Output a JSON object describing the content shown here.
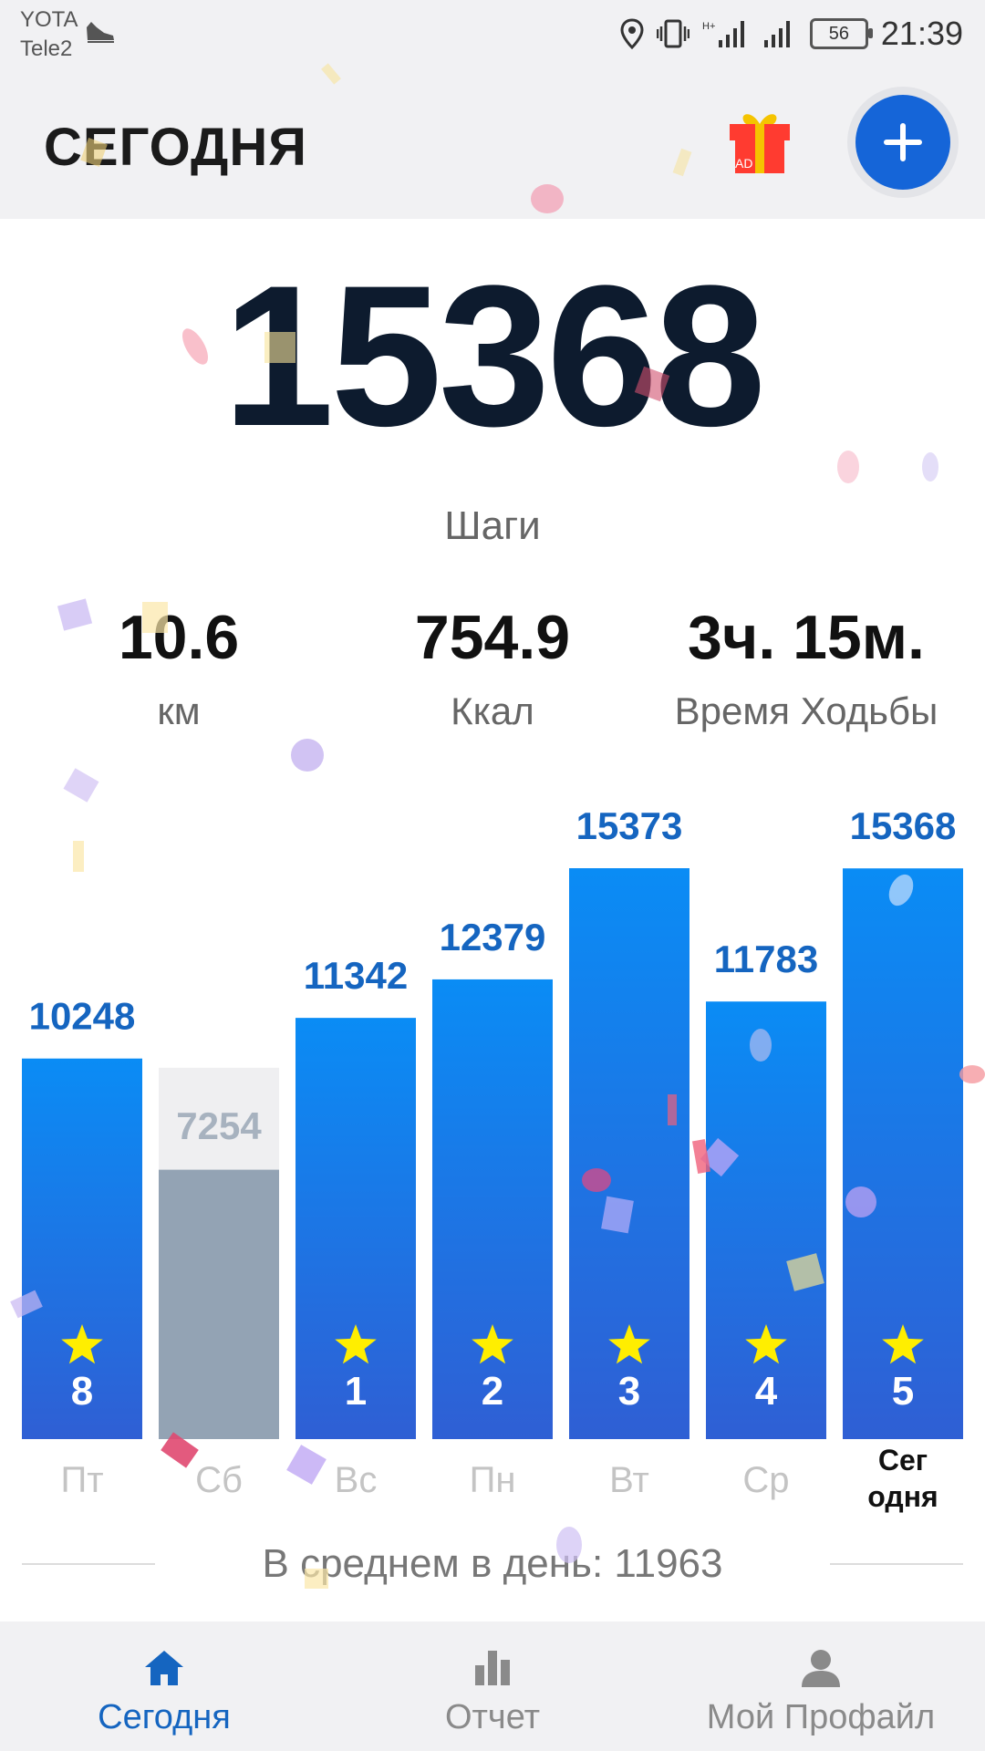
{
  "status_bar": {
    "carrier_1": "YOTA",
    "carrier_2": "Tele2",
    "battery": "56",
    "time": "21:39",
    "network": "H+"
  },
  "header": {
    "title": "СЕГОДНЯ",
    "gift_badge": "AD",
    "add_icon": "plus-icon",
    "gift_icon": "gift-icon"
  },
  "today": {
    "steps": "15368",
    "steps_label": "Шаги",
    "stats": [
      {
        "value": "10.6",
        "label": "км"
      },
      {
        "value": "754.9",
        "label": "Ккал"
      },
      {
        "value": "3ч. 15м.",
        "label": "Время Ходьбы"
      }
    ]
  },
  "chart_data": {
    "type": "bar",
    "categories": [
      "Пт",
      "Сб",
      "Вс",
      "Пн",
      "Вт",
      "Ср",
      "Сегодня"
    ],
    "category_display": [
      [
        "Пт"
      ],
      [
        "Сб"
      ],
      [
        "Вс"
      ],
      [
        "Пн"
      ],
      [
        "Вт"
      ],
      [
        "Ср"
      ],
      [
        "Сег",
        "одня"
      ]
    ],
    "values": [
      10248,
      7254,
      11342,
      12379,
      15373,
      11783,
      15368
    ],
    "value_labels": [
      "10248",
      "7254",
      "11342",
      "12379",
      "15373",
      "11783",
      "15368"
    ],
    "goal_reached": [
      true,
      false,
      true,
      true,
      true,
      true,
      true
    ],
    "streak_labels": [
      "8",
      "",
      "1",
      "2",
      "3",
      "4",
      "5"
    ],
    "goal": 10000,
    "ylim": [
      0,
      15373
    ],
    "colors": {
      "bar_top": "#0a8cf5",
      "bar_bottom": "#2f5fd4",
      "missed": "#93a3b4",
      "missed_bg": "#efeff1",
      "label": "#1565c0",
      "star": "#ffee00"
    }
  },
  "average": {
    "text": "В среднем в день: 11963"
  },
  "bottom_nav": {
    "items": [
      {
        "label": "Сегодня",
        "icon": "home-icon",
        "active": true
      },
      {
        "label": "Отчет",
        "icon": "bar-chart-icon",
        "active": false
      },
      {
        "label": "Мой Профайл",
        "icon": "profile-icon",
        "active": false
      }
    ],
    "active_color": "#1565c0",
    "inactive_color": "#8a8a8a"
  }
}
